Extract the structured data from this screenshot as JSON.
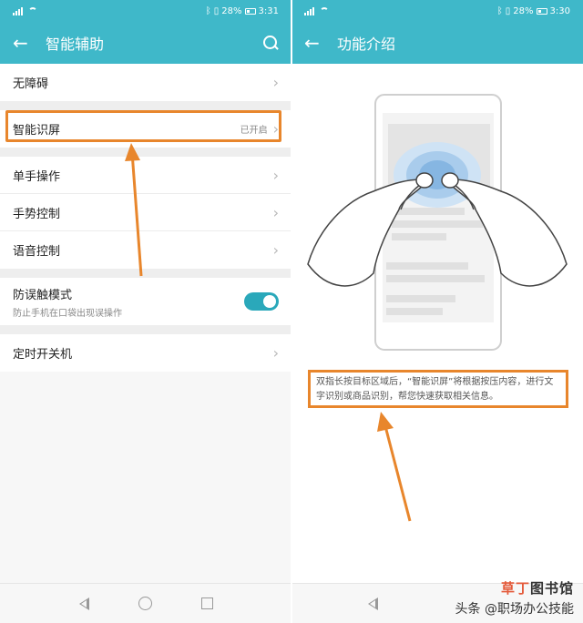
{
  "left_screen": {
    "status": {
      "battery": "28%",
      "time": "3:31"
    },
    "title": "智能辅助",
    "items": [
      {
        "label": "无障碍"
      },
      {
        "label": "智能识屏",
        "value": "已开启"
      },
      {
        "label": "单手操作"
      },
      {
        "label": "手势控制"
      },
      {
        "label": "语音控制"
      },
      {
        "label": "防误触模式",
        "sub": "防止手机在口袋出现误操作",
        "toggle": true
      },
      {
        "label": "定时开关机"
      }
    ]
  },
  "right_screen": {
    "status": {
      "battery": "28%",
      "time": "3:30"
    },
    "title": "功能介绍",
    "description": "双指长按目标区域后，“智能识屏”将根据按压内容，进行文字识别或商品识别，帮您快速获取相关信息。"
  },
  "watermark": {
    "line1_a": "草丁",
    "line1_b": "图书馆",
    "line2": "头条 @职场办公技能"
  },
  "colors": {
    "accent": "#3fb8c9",
    "toggle": "#2aa8ba",
    "highlight": "#e8862c"
  }
}
